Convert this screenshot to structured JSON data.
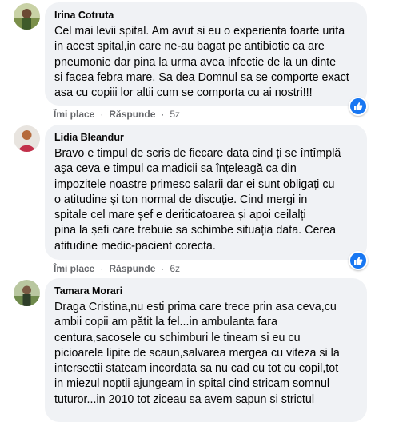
{
  "comments": [
    {
      "author": "Irina Cotruta",
      "text": "Cel mai levii spital. Am avut si eu o experienta foarte urita\nin acest spital,in care ne-au bagat pe antibiotic ca are\npneumonie dar pina la urma avea infectie de la un dinte\nsi facea febra mare. Sa dea Domnul sa se comporte exact\nasa cu copiii lor altii cum se comporta cu ai nostri!!!",
      "like_label": "Îmi place",
      "reply_label": "Răspunde",
      "time": "5z"
    },
    {
      "author": "Lidia Bleandur",
      "text": "Bravo e timpul de scris de fiecare data cind ți se întîmplă\naşa ceva e timpul ca madicii sa înțeleagă ca din\nimpozitele noastre primesc salarii dar ei sunt obligați cu\no atitudine și ton normal de discuție. Cind mergi in\nspitale cel mare șef e deriticatoarea și apoi ceilalți\npina la șefi care trebuie sa schimbe situația data. Cerea\natitudine medic-pacient corecta.",
      "like_label": "Îmi place",
      "reply_label": "Răspunde",
      "time": "6z"
    },
    {
      "author": "Tamara Morari",
      "text": "Draga Cristina,nu esti prima care trece prin asa ceva,cu\nambii copii am pătit la fel...in ambulanta fara\ncentura,sacosele cu schimburi le tineam si eu cu\npicioarele lipite de scaun,salvarea mergea cu viteza si la\nintersectii stateam incordata sa nu cad cu tot cu copil,tot\nin miezul noptii ajungeam in spital cind stricam somnul\ntuturor...in 2010 tot ziceau sa avem sapun si strictul"
    }
  ],
  "separator": "·",
  "colors": {
    "bubble": "#f0f2f5",
    "like_badge": "#1877f2",
    "meta": "#65676b"
  },
  "icons": {
    "reaction": "like-thumb-icon"
  }
}
